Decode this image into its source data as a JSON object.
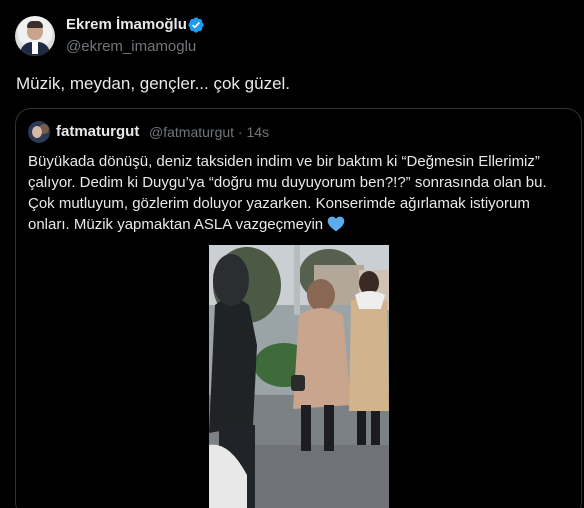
{
  "author": {
    "name": "Ekrem İmamoğlu",
    "handle": "@ekrem_imamoglu",
    "verified": true
  },
  "tweet": {
    "text": "Müzik, meydan, gençler... çok güzel."
  },
  "quoted": {
    "name": "fatmaturgut",
    "handle": "@fatmaturgut",
    "separator": "·",
    "time": "14s",
    "text": "Büyükada dönüşü, deniz taksiden indim ve bir baktım ki “Değmesin Ellerimiz” çalıyor. Dedim ki Duygu’ya “doğru mu duyuyorum ben?!?” sonrasında olan bu. Çok mutluyum, gözlerim doluyor yazarken. Konserimde ağırlamak istiyorum onları. Müzik yapmaktan ASLA vazgeçmeyin",
    "emoji": "blue-heart-icon"
  },
  "colors": {
    "background": "#000000",
    "text": "#e7e9ea",
    "secondary": "#71767b",
    "border": "#2f3336",
    "verified": "#1d9bf0"
  }
}
